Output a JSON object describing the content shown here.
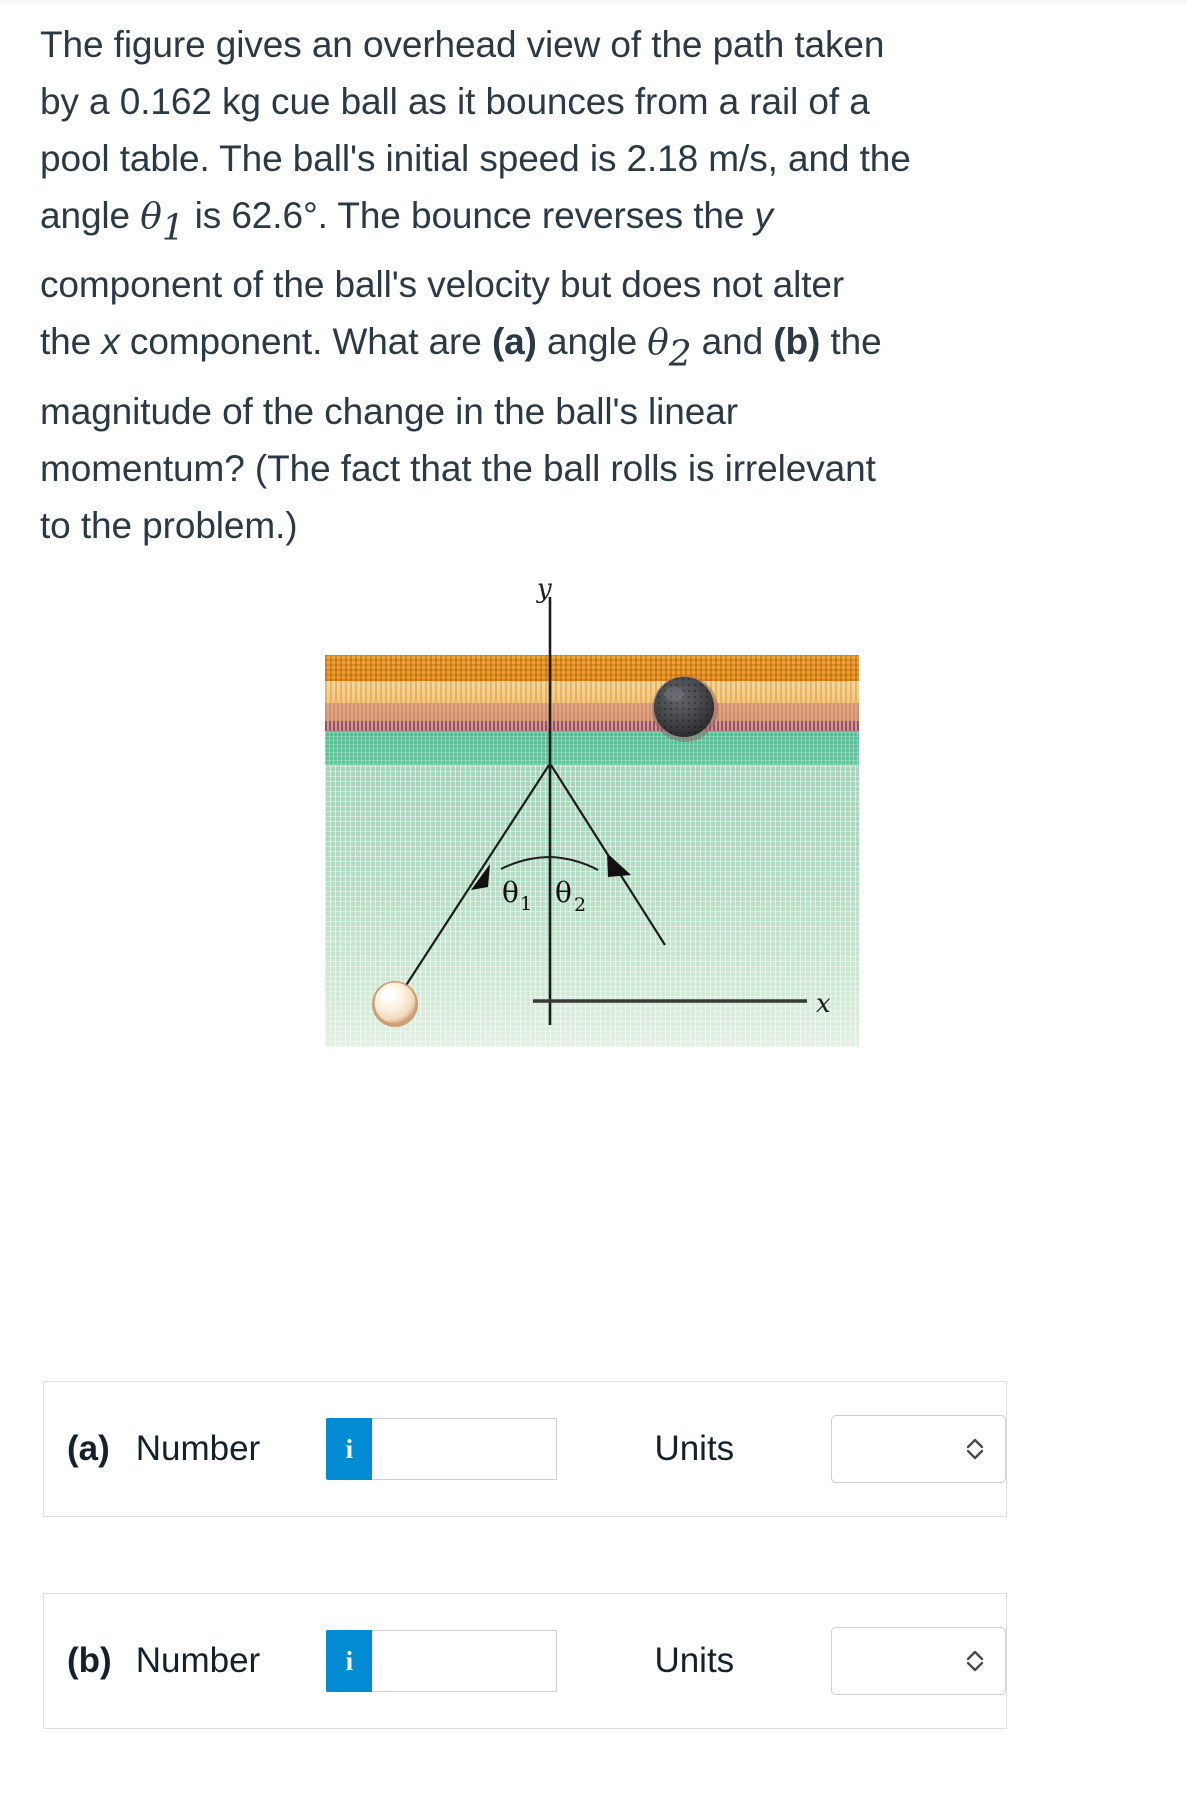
{
  "question": {
    "line1": "The figure gives an overhead view of the path taken",
    "line2": "by a 0.162 kg cue ball as it bounces from a rail of a",
    "line3": "pool table. The ball's initial speed is 2.18 m/s, and the",
    "line4_a": "angle ",
    "line4_theta": "θ",
    "line4_sub": "1",
    "line4_b": " is 62.6°. The bounce reverses the ",
    "line4_x": "y",
    "line5": "component of the ball's velocity but does not alter",
    "line6_a": "the ",
    "line6_x": "x",
    "line6_b": " component. What are ",
    "line6_bold_a": "(a)",
    "line6_c": " angle ",
    "line6_theta": "θ",
    "line6_sub": "2",
    "line6_d": " and ",
    "line6_bold_b": "(b)",
    "line6_e": " the",
    "line7": "magnitude of the change in the ball's linear",
    "line8": "momentum? (The fact that the ball rolls is irrelevant",
    "line9": "to the problem.)",
    "mass": "0.162 kg",
    "speed": "2.18 m/s",
    "angle1": "62.6°"
  },
  "figure": {
    "y_axis_label": "y",
    "x_axis_label": "x",
    "theta1_label": "θ",
    "theta1_sub": "1",
    "theta2_label": "θ",
    "theta2_sub": "2",
    "cue_ball_name": "cue-ball",
    "eight_ball_name": "eight-ball",
    "rail_name": "pool-table-rail",
    "felt_color": "#b3dcc3",
    "rail_color": "#e99a29",
    "felt_dark_color": "#4fbf94"
  },
  "answers": [
    {
      "tag": "(a)",
      "number_label": "Number",
      "info_glyph": "i",
      "number_value": "",
      "number_placeholder": "",
      "units_label": "Units",
      "units_value": "",
      "chevron": "updown-chevron-icon"
    },
    {
      "tag": "(b)",
      "number_label": "Number",
      "info_glyph": "i",
      "number_value": "",
      "number_placeholder": "",
      "units_label": "Units",
      "units_value": "",
      "chevron": "updown-chevron-icon"
    }
  ],
  "colors": {
    "accent_blue": "#008bd2",
    "text": "#2b3945",
    "border": "#dfdfe1"
  }
}
